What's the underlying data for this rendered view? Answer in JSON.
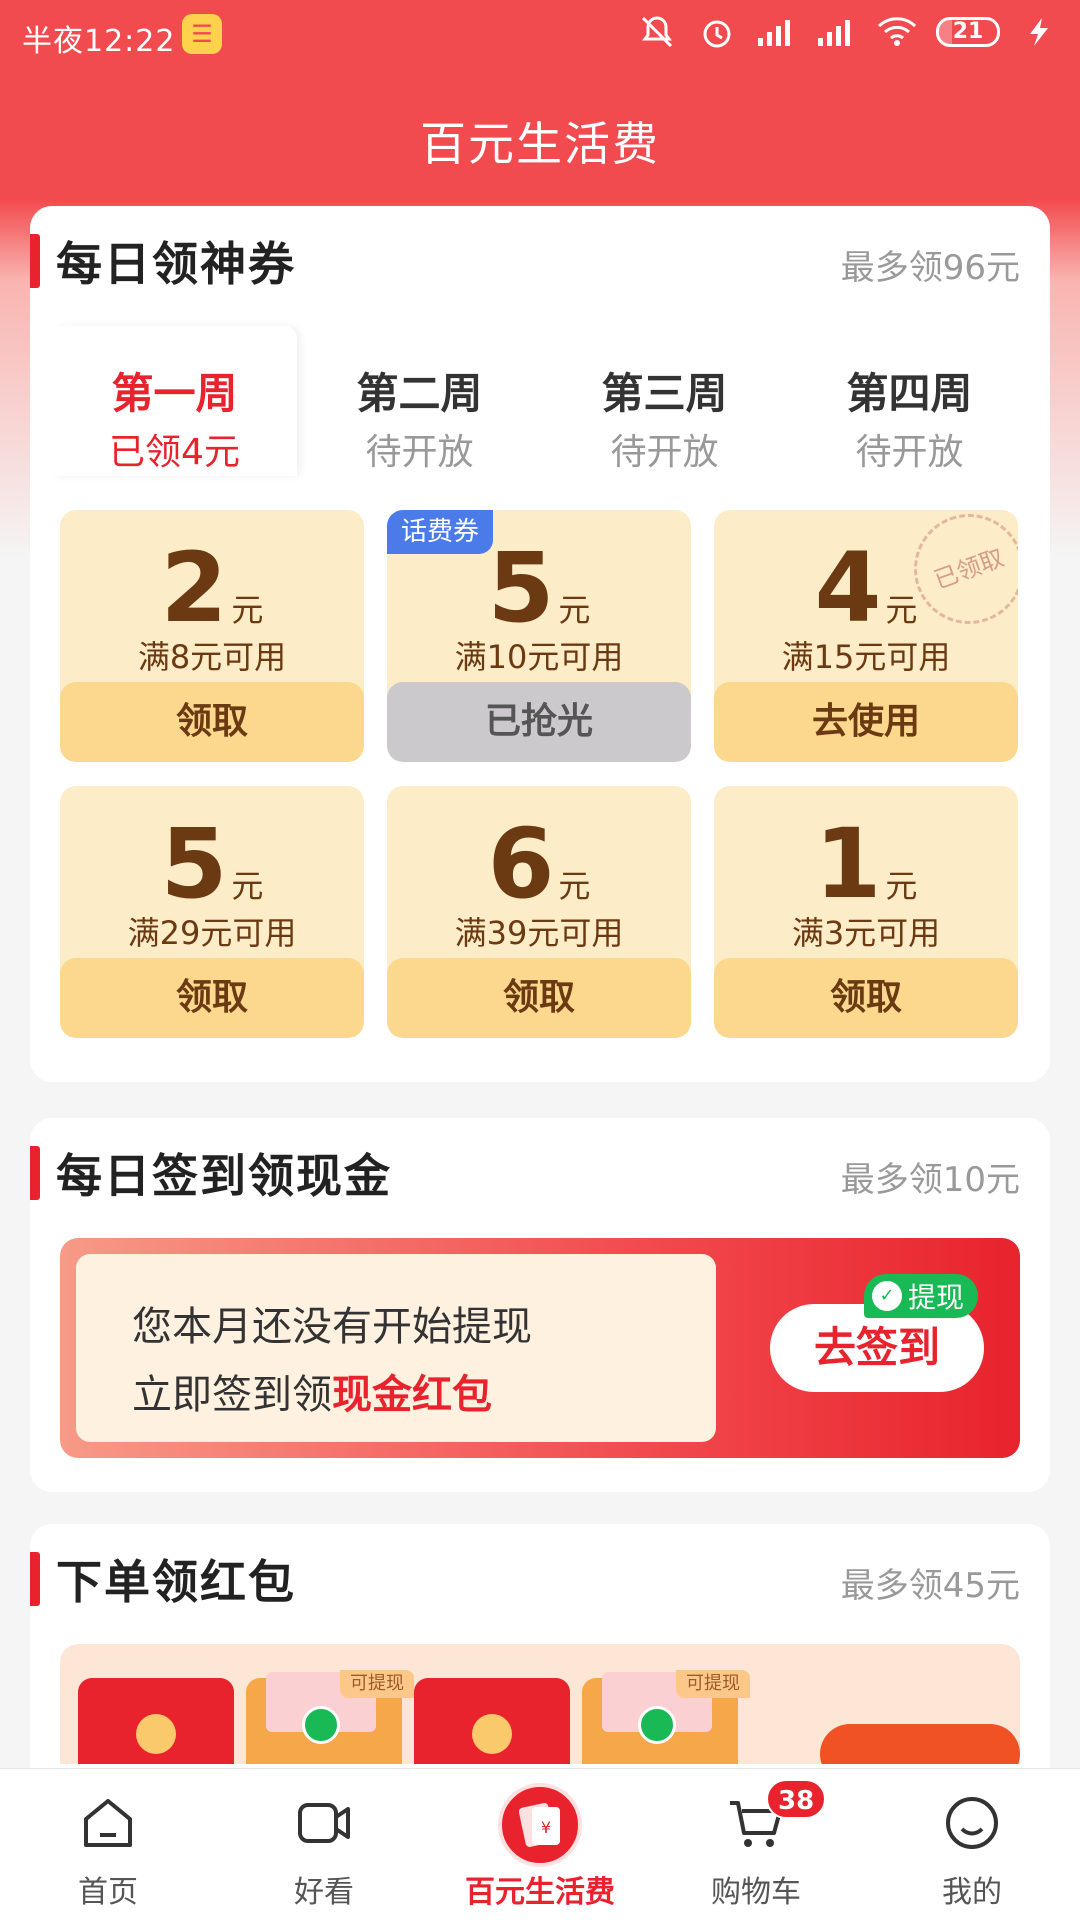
{
  "status_bar": {
    "time": "半夜12:22",
    "battery": "21",
    "icons": [
      "mute-icon",
      "alarm-icon",
      "hd-signal-icon",
      "signal-icon",
      "wifi-icon",
      "battery-icon",
      "charging-icon"
    ]
  },
  "header": {
    "title": "百元生活费"
  },
  "coupons_section": {
    "title": "每日领神券",
    "note": "最多领96元",
    "weeks": [
      {
        "name": "第一周",
        "status": "已领4元",
        "active": true
      },
      {
        "name": "第二周",
        "status": "待开放",
        "active": false
      },
      {
        "name": "第三周",
        "status": "待开放",
        "active": false
      },
      {
        "name": "第四周",
        "status": "待开放",
        "active": false
      }
    ],
    "coupons": [
      {
        "amount": "2",
        "unit": "元",
        "condition": "满8元可用",
        "button": "领取"
      },
      {
        "amount": "5",
        "unit": "元",
        "condition": "满10元可用",
        "button": "已抢光",
        "tag": "话费券"
      },
      {
        "amount": "4",
        "unit": "元",
        "condition": "满15元可用",
        "button": "去使用",
        "stamp": "已领取"
      },
      {
        "amount": "5",
        "unit": "元",
        "condition": "满29元可用",
        "button": "领取"
      },
      {
        "amount": "6",
        "unit": "元",
        "condition": "满39元可用",
        "button": "领取"
      },
      {
        "amount": "1",
        "unit": "元",
        "condition": "满3元可用",
        "button": "领取"
      }
    ]
  },
  "signin_section": {
    "title": "每日签到领现金",
    "note": "最多领10元",
    "line1": "您本月还没有开始提现",
    "line2_prefix": "立即签到领",
    "line2_highlight": "现金红包",
    "button": "去签到",
    "badge": "提现"
  },
  "order_section": {
    "title": "下单领红包",
    "note": "最多领45元",
    "envelope_tag": "可提现"
  },
  "bottom_nav": {
    "items": [
      {
        "label": "首页",
        "icon": "home-icon"
      },
      {
        "label": "好看",
        "icon": "video-icon"
      },
      {
        "label": "百元生活费",
        "icon": "red-envelope-icon"
      },
      {
        "label": "购物车",
        "icon": "cart-icon"
      },
      {
        "label": "我的",
        "icon": "profile-icon"
      }
    ],
    "cart_badge": "38"
  },
  "colors": {
    "brand_red": "#f24b4f",
    "accent_red": "#e8232d",
    "coupon_bg": "#fdecc8",
    "coupon_button": "#fbd88e",
    "wechat_green": "#19b955"
  }
}
